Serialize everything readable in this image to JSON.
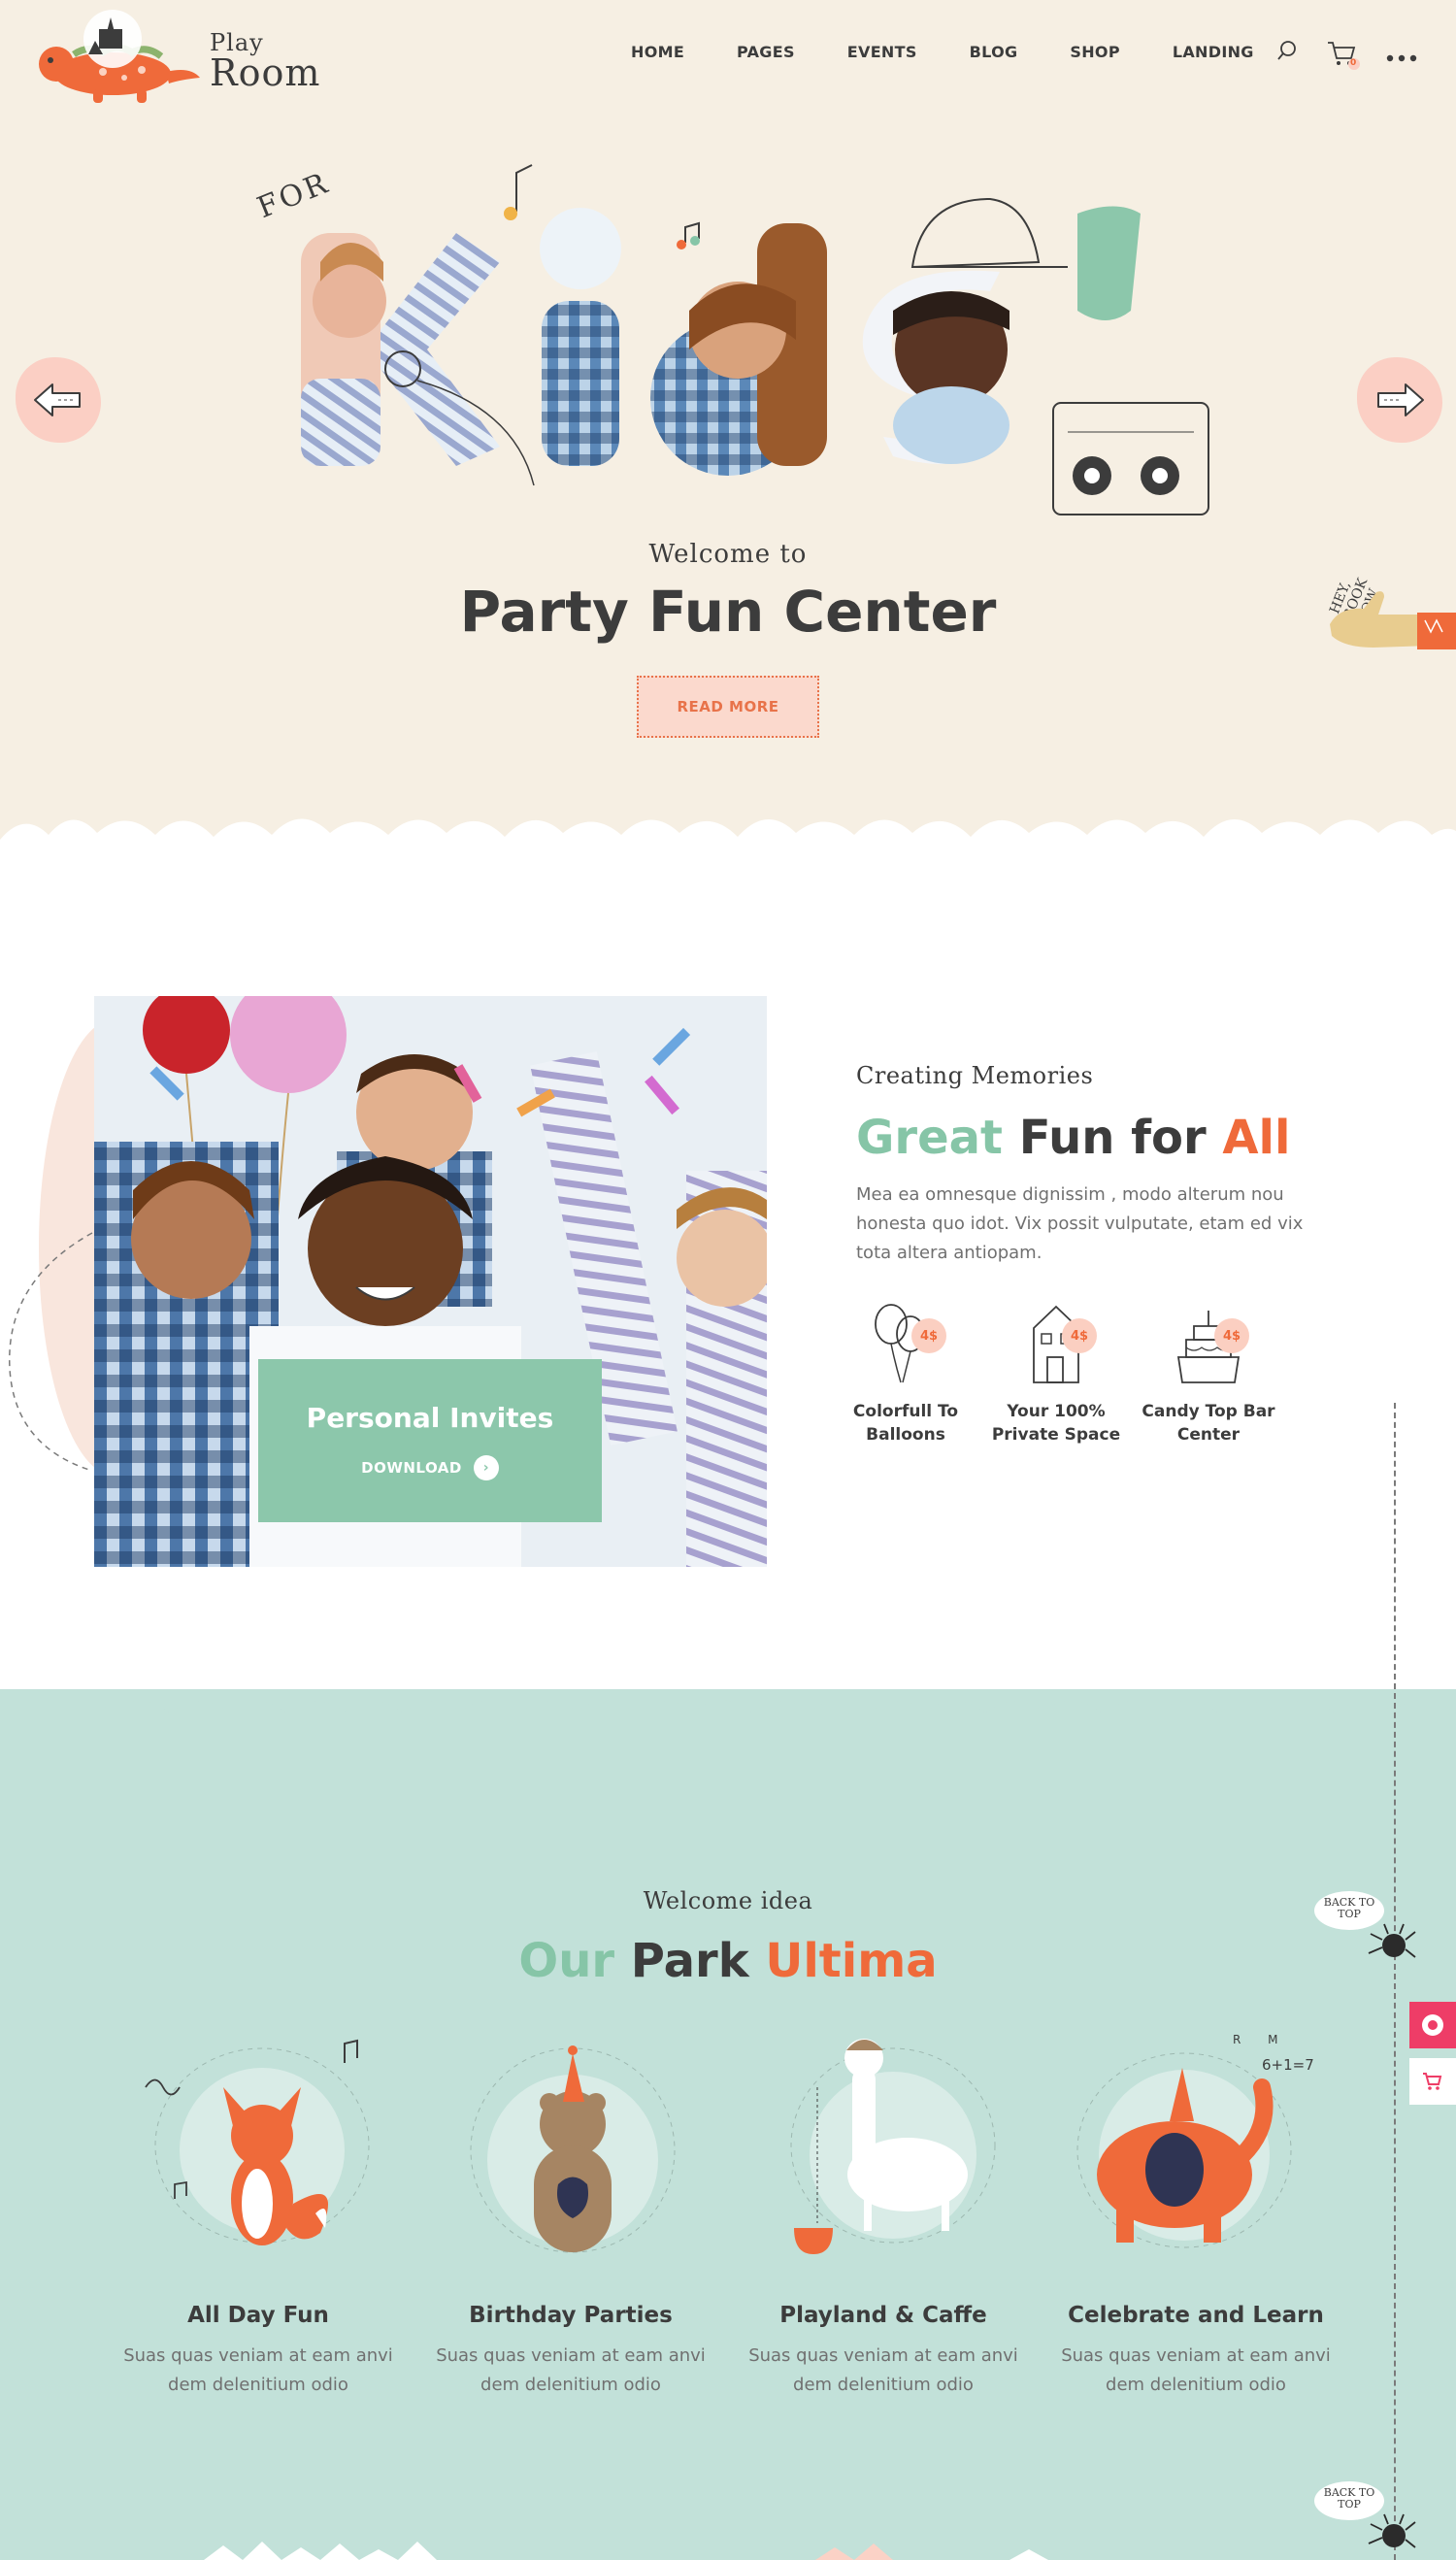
{
  "brand": {
    "line1": "Play",
    "line2": "Room"
  },
  "nav": {
    "items": [
      {
        "label": "HOME",
        "active": true
      },
      {
        "label": "PAGES"
      },
      {
        "label": "EVENTS"
      },
      {
        "label": "BLOG"
      },
      {
        "label": "SHOP"
      },
      {
        "label": "LANDING"
      }
    ],
    "icons": [
      "search-icon",
      "cart-icon",
      "more-icon"
    ],
    "cart_badge": "0"
  },
  "hero": {
    "for_text": "FOR",
    "big_word": "Kids",
    "welcome": "Welcome to",
    "title": "Party Fun Center",
    "button": "READ MORE",
    "book_now": "HEY, BOOK NOW"
  },
  "invites": {
    "title": "Personal Invites",
    "download": "DOWNLOAD"
  },
  "memories": {
    "kicker": "Creating Memories",
    "title_parts": [
      "Great",
      "Fun for",
      "All"
    ],
    "text": "Mea ea omnesque dignissim , modo alterum nou honesta quo idot. Vix possit vulputate, etam ed vix tota altera antiopam.",
    "features": [
      {
        "label": "Colorfull To Balloons",
        "price": "4$",
        "icon": "balloons-icon"
      },
      {
        "label": "Your 100% Private Space",
        "price": "4$",
        "icon": "house-icon"
      },
      {
        "label": "Candy Top Bar Center",
        "price": "4$",
        "icon": "cake-icon"
      }
    ]
  },
  "park": {
    "kicker": "Welcome idea",
    "title_parts": [
      "Our",
      "Park",
      "Ultima"
    ],
    "cards": [
      {
        "title": "All Day Fun",
        "text": "Suas quas veniam at eam anvi dem delenitium odio",
        "icon": "fox-icon"
      },
      {
        "title": "Birthday Parties",
        "text": "Suas quas veniam at eam anvi dem delenitium odio",
        "icon": "bear-icon"
      },
      {
        "title": "Playland & Caffe",
        "text": "Suas quas veniam at eam anvi dem delenitium odio",
        "icon": "llama-icon"
      },
      {
        "title": "Celebrate and Learn",
        "text": "Suas quas veniam at eam anvi dem delenitium odio",
        "icon": "elephant-icon"
      }
    ],
    "math_note": "6+1=7",
    "math_letters": "R M"
  },
  "back_to_top": "BACK TO TOP",
  "colors": {
    "cream": "#f6efe3",
    "mint": "#c2e1d9",
    "green": "#86c5a7",
    "orange": "#ef6a3a",
    "pink": "#fbcfc4",
    "dark": "#3c3c3c",
    "side_pink": "#ee3d67"
  }
}
